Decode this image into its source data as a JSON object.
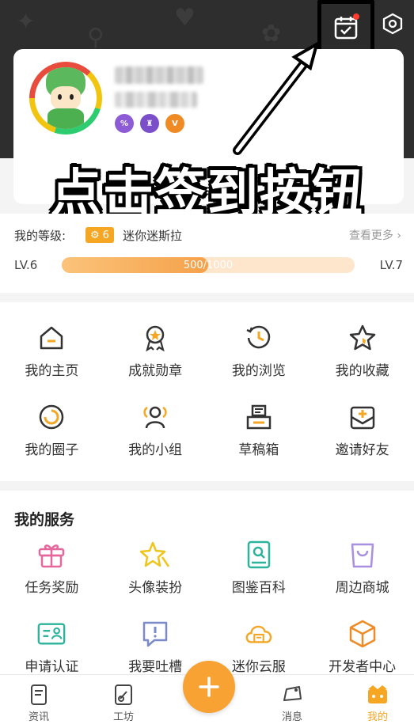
{
  "header": {
    "checkin_icon": "calendar-check-icon",
    "settings_icon": "settings-hex-icon"
  },
  "profile": {
    "avatar": "cartoon-avatar",
    "name_blurred": true,
    "badges": [
      {
        "label": "%",
        "color": "#8e5bd6",
        "icon": "badge-icon-1"
      },
      {
        "label": "♜",
        "color": "#7b4fc9",
        "icon": "badge-icon-2"
      },
      {
        "label": "V",
        "color": "#f08a24",
        "icon": "v-badge-icon"
      }
    ]
  },
  "overlay": {
    "caption": "点击签到按钮"
  },
  "level": {
    "label": "我的等级:",
    "chip_value": "6",
    "name": "迷你迷斯拉",
    "view_more": "查看更多 ›",
    "current": "LV.6",
    "next": "LV.7",
    "progress_text": "500/1000",
    "progress_fraction": 0.5
  },
  "features": [
    {
      "label": "我的主页",
      "icon": "home-icon"
    },
    {
      "label": "成就勋章",
      "icon": "medal-icon"
    },
    {
      "label": "我的浏览",
      "icon": "history-icon"
    },
    {
      "label": "我的收藏",
      "icon": "star-icon"
    },
    {
      "label": "我的圈子",
      "icon": "circle-icon"
    },
    {
      "label": "我的小组",
      "icon": "group-icon"
    },
    {
      "label": "草稿箱",
      "icon": "draft-box-icon"
    },
    {
      "label": "邀请好友",
      "icon": "invite-icon"
    }
  ],
  "services": {
    "title": "我的服务",
    "items": [
      {
        "label": "任务奖励",
        "icon": "gift-icon"
      },
      {
        "label": "头像装扮",
        "icon": "sparkle-star-icon"
      },
      {
        "label": "图鉴百科",
        "icon": "book-icon"
      },
      {
        "label": "周边商城",
        "icon": "shopping-bag-icon"
      },
      {
        "label": "申请认证",
        "icon": "id-card-icon"
      },
      {
        "label": "我要吐槽",
        "icon": "feedback-icon"
      },
      {
        "label": "迷你云服",
        "icon": "cloud-server-icon"
      },
      {
        "label": "开发者中心",
        "icon": "cube-icon"
      }
    ]
  },
  "tabbar": {
    "tabs": [
      {
        "label": "资讯",
        "icon": "news-icon"
      },
      {
        "label": "工坊",
        "icon": "workshop-icon"
      },
      {
        "label": "消息",
        "icon": "message-icon"
      },
      {
        "label": "我的",
        "icon": "profile-icon"
      }
    ],
    "fab_icon": "plus-icon",
    "active_color": "#f5a623"
  },
  "colors": {
    "accent": "#f5a623",
    "header_bg": "#2e2e2e",
    "icon_dark": "#333333"
  }
}
